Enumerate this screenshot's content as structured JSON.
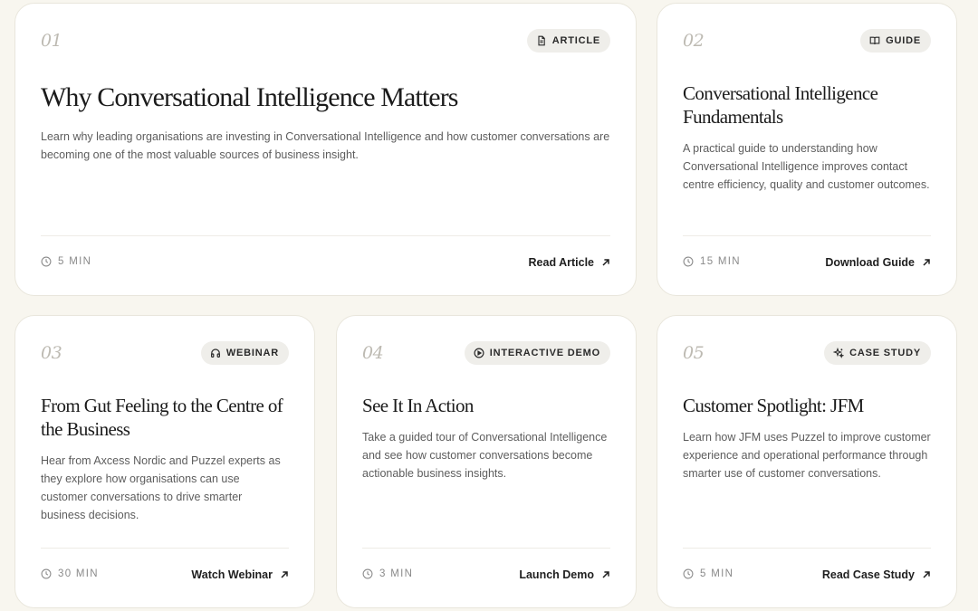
{
  "cards": [
    {
      "number": "01",
      "badge": "ARTICLE",
      "badge_icon": "document-icon",
      "title": "Why Conversational Intelligence Matters",
      "description": "Learn why leading organisations are investing in Conversational Intelligence and how customer conversations are becoming one of the most valuable sources of business insight.",
      "duration": "5 MIN",
      "cta": "Read Article"
    },
    {
      "number": "02",
      "badge": "GUIDE",
      "badge_icon": "book-icon",
      "title": "Conversational Intelligence Fundamentals",
      "description": "A practical guide to understanding how Conversational Intelligence improves contact centre efficiency, quality and customer outcomes.",
      "duration": "15 MIN",
      "cta": "Download Guide"
    },
    {
      "number": "03",
      "badge": "WEBINAR",
      "badge_icon": "headphones-icon",
      "title": "From Gut Feeling to the Centre of the Business",
      "description": "Hear from Axcess Nordic and Puzzel experts as they explore how organisations can use customer conversations to drive smarter business decisions.",
      "duration": "30 MIN",
      "cta": "Watch Webinar"
    },
    {
      "number": "04",
      "badge": "INTERACTIVE DEMO",
      "badge_icon": "play-circle-icon",
      "title": "See It In Action",
      "description": "Take a guided tour of Conversational Intelligence and see how customer conversations become actionable business insights.",
      "duration": "3 MIN",
      "cta": "Launch Demo"
    },
    {
      "number": "05",
      "badge": "CASE STUDY",
      "badge_icon": "sparkles-icon",
      "title": "Customer Spotlight: JFM",
      "description": "Learn how JFM uses Puzzel to improve customer experience and operational performance through smarter use of customer conversations.",
      "duration": "5 MIN",
      "cta": "Read Case Study"
    }
  ]
}
